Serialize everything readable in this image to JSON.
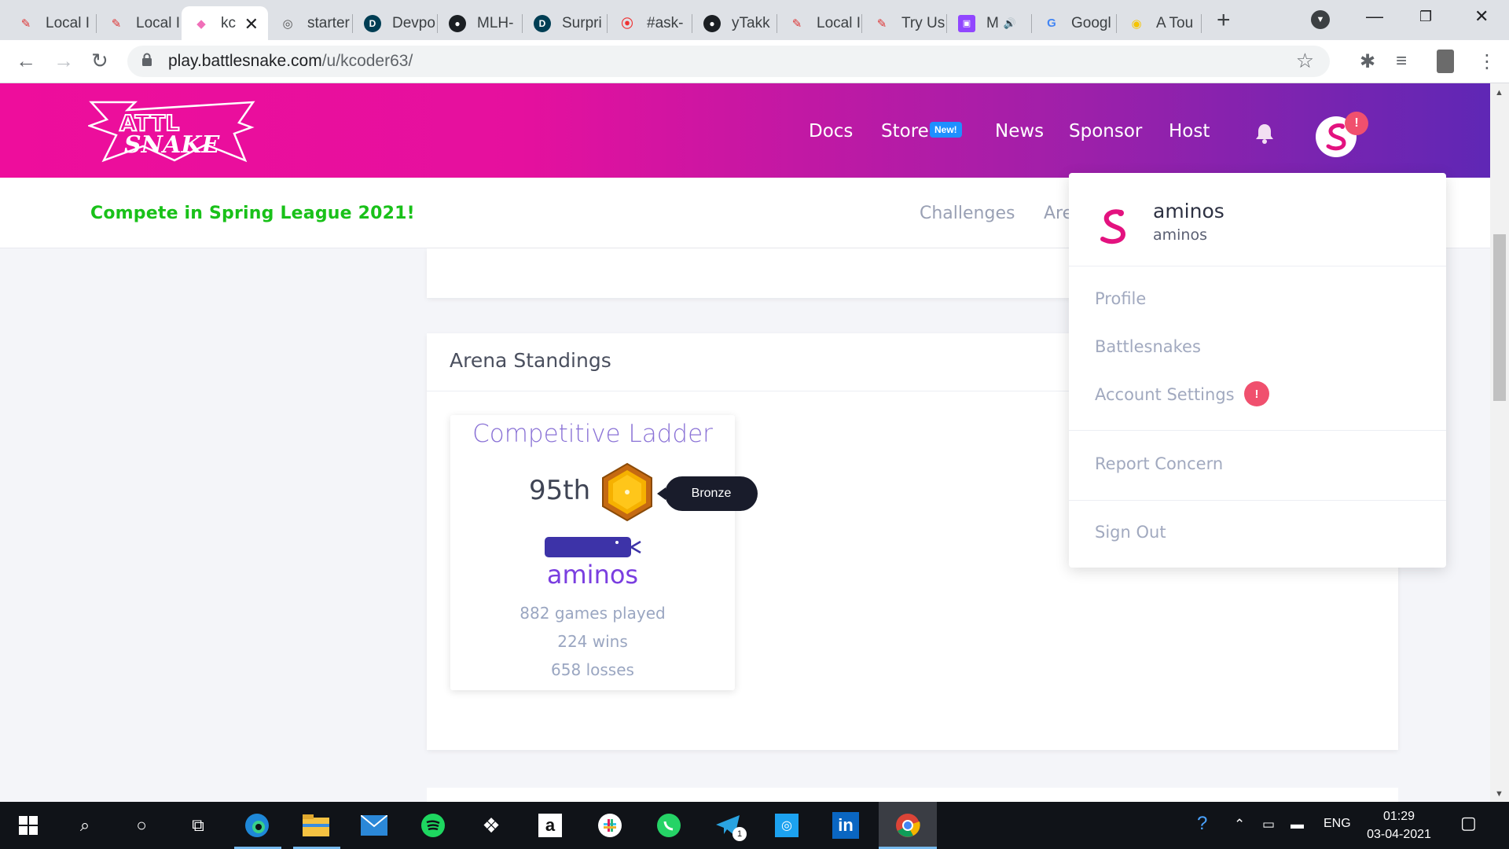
{
  "browser": {
    "tabs": [
      {
        "title": "Local I",
        "favicon": "pencil-icon"
      },
      {
        "title": "Local I",
        "favicon": "pencil-icon"
      },
      {
        "title": "kc",
        "favicon": "battlesnake-icon"
      },
      {
        "title": "starter",
        "favicon": "swirl-icon"
      },
      {
        "title": "Devpo",
        "favicon": "devpost-icon"
      },
      {
        "title": "MLH-",
        "favicon": "github-icon"
      },
      {
        "title": "Surpri",
        "favicon": "devpost-icon"
      },
      {
        "title": "#ask-",
        "favicon": "record-icon"
      },
      {
        "title": "yTakk",
        "favicon": "github-icon"
      },
      {
        "title": "Local I",
        "favicon": "pencil-icon"
      },
      {
        "title": "Try Us",
        "favicon": "pencil-icon"
      },
      {
        "title": "M",
        "favicon": "twitch-icon"
      },
      {
        "title": "Googl",
        "favicon": "google-icon"
      },
      {
        "title": "A Tou",
        "favicon": "circle-icon"
      }
    ],
    "url_host": "play.battlesnake.com",
    "url_path": "/u/kcoder63/"
  },
  "site": {
    "nav": [
      "Docs",
      "Store",
      "News",
      "Sponsor",
      "Host"
    ],
    "store_badge": "New!",
    "avatar_alert": "!",
    "promo": "Compete in Spring League 2021!",
    "subnav": [
      "Challenges",
      "Are"
    ]
  },
  "arena": {
    "title": "Arena Standings",
    "ladder": {
      "title": "Competitive Ladder",
      "rank": "95th",
      "tier_tooltip": "Bronze",
      "snake_name": "aminos",
      "games_played": "882 games played",
      "wins": "224 wins",
      "losses": "658 losses",
      "snake_color": "#3d33a8"
    }
  },
  "dropdown": {
    "display_name": "aminos",
    "username": "aminos",
    "items": [
      "Profile",
      "Battlesnakes",
      "Account Settings",
      "Report Concern",
      "Sign Out"
    ],
    "settings_alert": "!"
  },
  "taskbar": {
    "telegram_badge": "1",
    "lang": "ENG",
    "time": "01:29",
    "date": "03-04-2021"
  },
  "colors": {
    "header_start": "#ee0d9c",
    "header_end": "#5f27b5",
    "promo": "#19c119",
    "ladder_title": "#8a72d6",
    "alert": "#f0506e"
  }
}
